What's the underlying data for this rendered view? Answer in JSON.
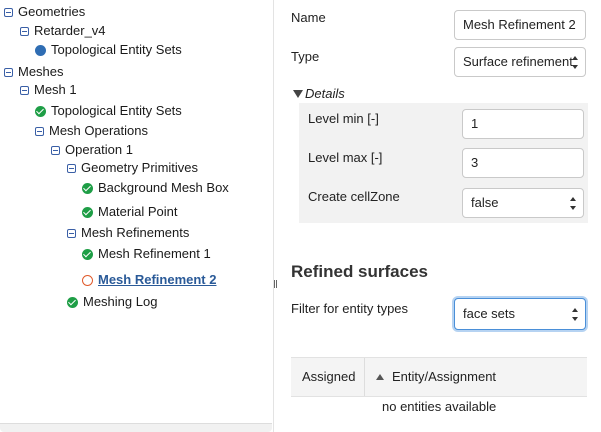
{
  "tree": {
    "items": [
      {
        "label": "Geometries"
      },
      {
        "label": "Retarder_v4"
      },
      {
        "label": "Topological Entity Sets"
      },
      {
        "label": "Meshes"
      },
      {
        "label": "Mesh 1"
      },
      {
        "label": "Topological Entity Sets"
      },
      {
        "label": "Mesh Operations"
      },
      {
        "label": "Operation 1"
      },
      {
        "label": "Geometry Primitives"
      },
      {
        "label": "Background Mesh Box"
      },
      {
        "label": "Material Point"
      },
      {
        "label": "Mesh Refinements"
      },
      {
        "label": "Mesh Refinement 1"
      },
      {
        "label": "Mesh Refinement 2"
      },
      {
        "label": "Meshing Log"
      }
    ]
  },
  "props": {
    "name_label": "Name",
    "name_value": "Mesh Refinement 2",
    "type_label": "Type",
    "type_value": "Surface refinement",
    "details_label": "Details",
    "level_min_label": "Level min [-]",
    "level_min_value": "1",
    "level_max_label": "Level max [-]",
    "level_max_value": "3",
    "cellzone_label": "Create cellZone",
    "cellzone_value": "false",
    "section_title": "Refined surfaces",
    "filter_label": "Filter for entity types",
    "filter_value": "face sets",
    "table": {
      "col_assigned": "Assigned",
      "col_entity": "Entity/Assignment",
      "empty": "no entities available"
    }
  },
  "colors": {
    "ok": "#1e9e46",
    "set": "#2f6db3",
    "pending": "#e05a2b",
    "selected_text": "#2a5a98",
    "focus": "#4a8fd8"
  },
  "icons": {
    "toggle": "collapse-toggle-icon",
    "ok": "check-circle-icon",
    "set": "filled-circle-icon",
    "pending": "open-circle-icon"
  }
}
